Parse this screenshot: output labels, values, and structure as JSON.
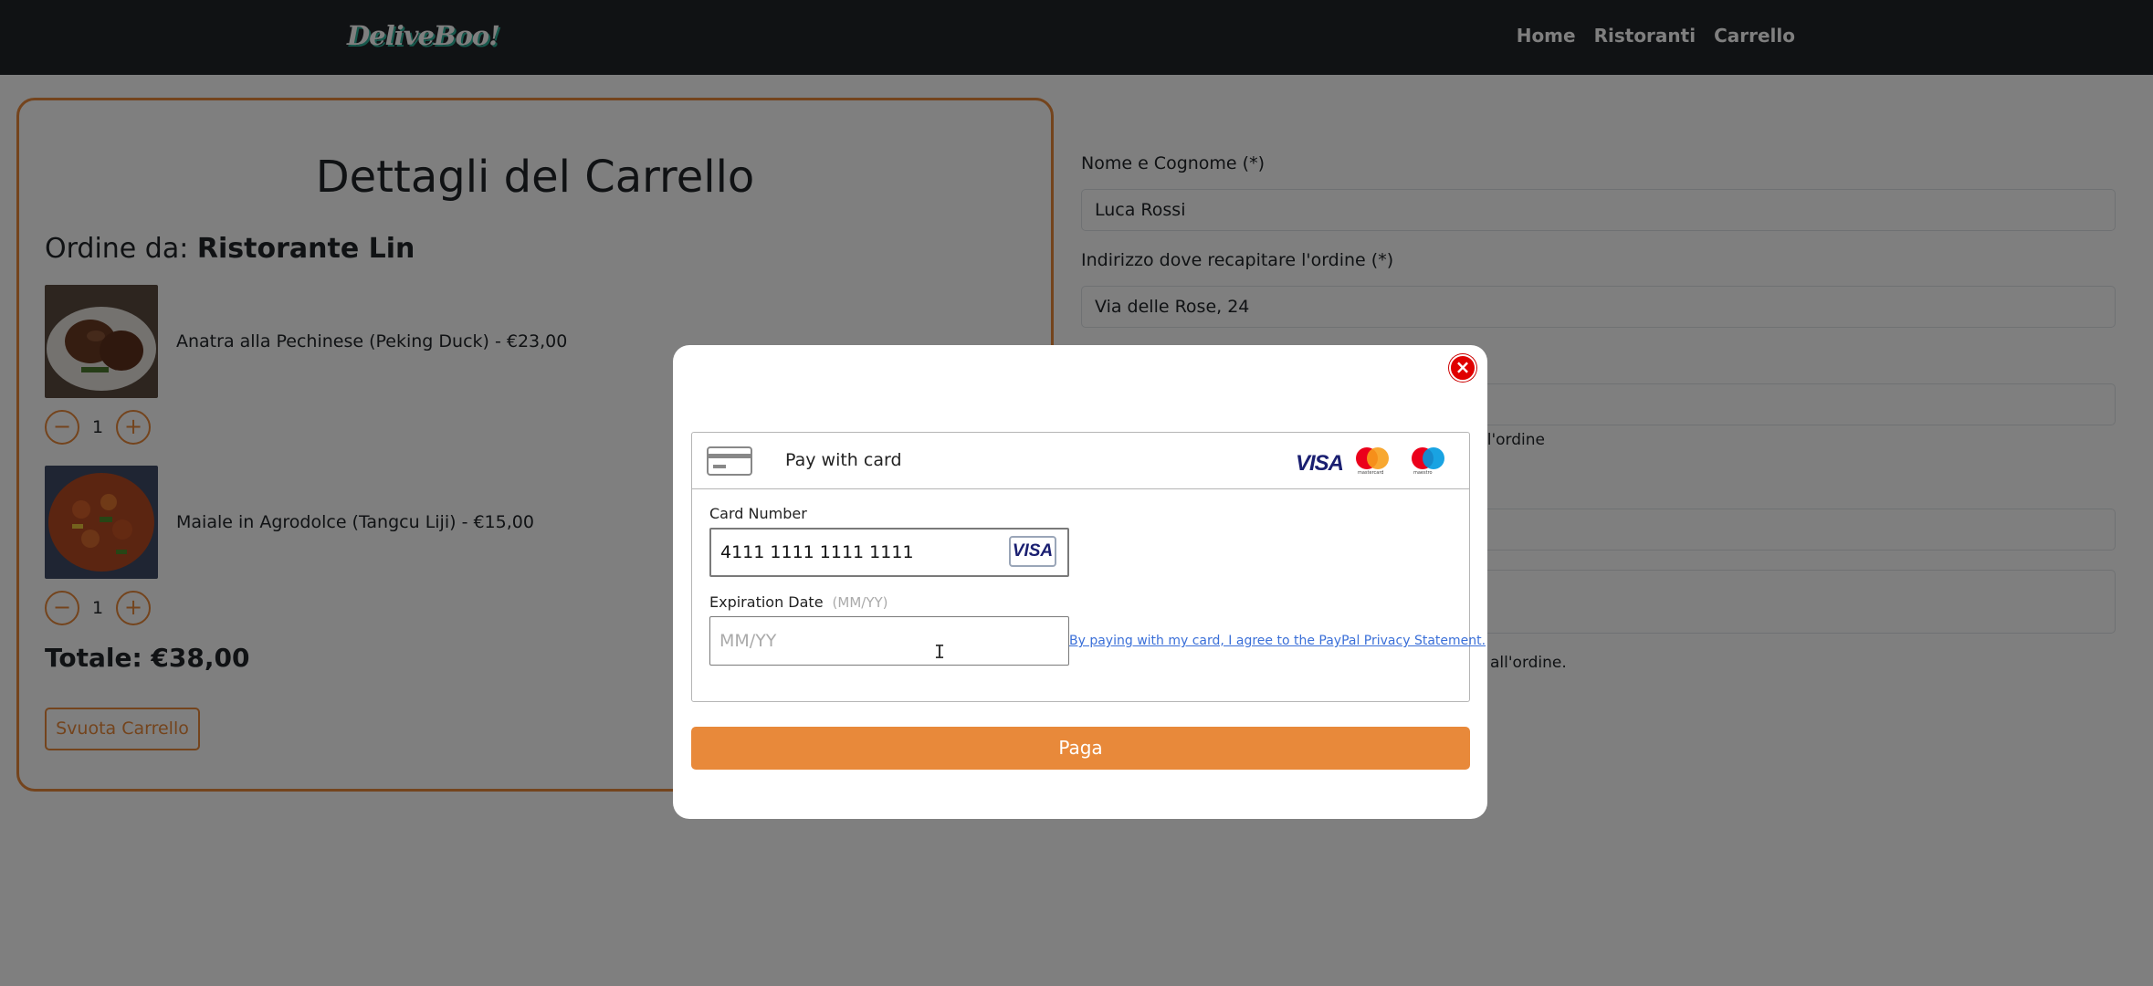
{
  "navbar": {
    "logo": "DeliveBoo!",
    "links": [
      "Home",
      "Ristoranti",
      "Carrello"
    ]
  },
  "cart": {
    "title": "Dettagli del Carrello",
    "order_from_label": "Ordine da:",
    "restaurant": "Ristorante Lin",
    "items": [
      {
        "name": "Anatra alla Pechinese (Peking Duck) - €23,00",
        "qty": "1"
      },
      {
        "name": "Maiale in Agrodolce (Tangcu Liji) - €15,00",
        "qty": "1"
      }
    ],
    "minus": "−",
    "plus": "+",
    "total": "Totale: €38,00",
    "empty_button": "Svuota Carrello"
  },
  "form": {
    "name_label": "Nome e Cognome (*)",
    "name_value": "Luca Rossi",
    "address_label": "Indirizzo dove recapitare l'ordine (*)",
    "address_value": "Via delle Rose, 24",
    "helper_1": "ll'ordine",
    "helper_2": "all'ordine."
  },
  "modal": {
    "close": "×",
    "pay_with_card": "Pay with card",
    "brands": [
      "VISA",
      "mastercard",
      "maestro"
    ],
    "card_number_label": "Card Number",
    "card_number_value": "4111 1111 1111 1111",
    "card_brand_badge": "VISA",
    "expiration_label": "Expiration Date",
    "expiration_hint": "(MM/YY)",
    "expiration_placeholder": "MM/YY",
    "privacy_text": "By paying with my card, I agree to the PayPal Privacy Statement.",
    "pay_button": "Paga"
  },
  "colors": {
    "accent": "#e8893a",
    "navbar": "#212529",
    "close": "#e00000",
    "visa_blue": "#1a1f71"
  }
}
